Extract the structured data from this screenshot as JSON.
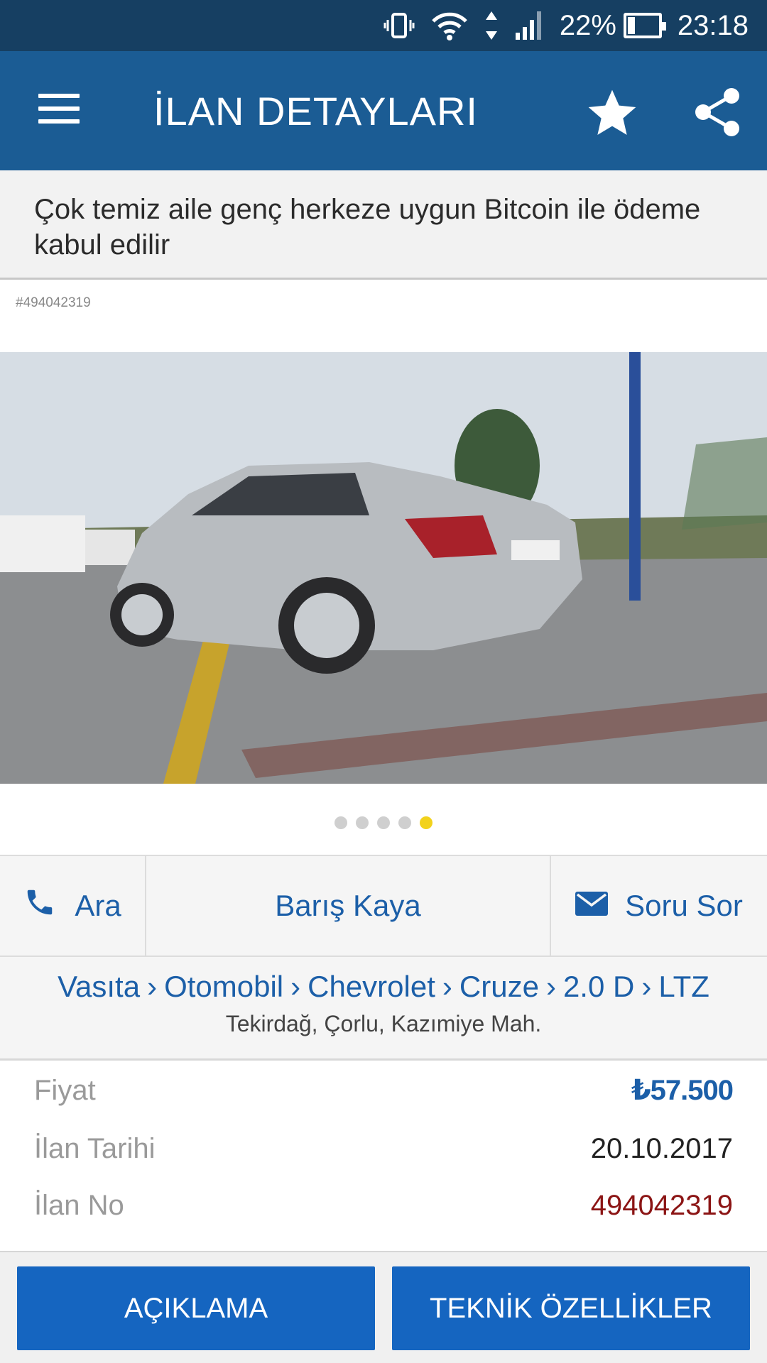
{
  "status_bar": {
    "battery_percent": "22%",
    "battery_level": 0.22,
    "time": "23:18"
  },
  "app_bar": {
    "title": "İLAN DETAYLARI"
  },
  "listing": {
    "title": "Çok temiz aile genç herkeze uygun Bitcoin ile ödeme kabul edilir",
    "hash_id": "#494042319"
  },
  "gallery": {
    "photo_count": 5,
    "active_index": 4
  },
  "actions": {
    "call_label": "Ara",
    "seller_name": "Barış Kaya",
    "ask_label": "Soru Sor"
  },
  "breadcrumb": [
    "Vasıta",
    "Otomobil",
    "Chevrolet",
    "Cruze",
    "2.0 D",
    "LTZ"
  ],
  "breadcrumb_separator": "›",
  "location": "Tekirdağ, Çorlu, Kazımiye Mah.",
  "details": {
    "price_label": "Fiyat",
    "price_value": "₺57.500",
    "date_label": "İlan Tarihi",
    "date_value": "20.10.2017",
    "no_label": "İlan No",
    "no_value": "494042319"
  },
  "bottom_buttons": {
    "description": "AÇIKLAMA",
    "technical": "TEKNİK ÖZELLİKLER"
  },
  "colors": {
    "status_bar": "#163f62",
    "app_bar": "#1b5c94",
    "link_blue": "#1c5fa8",
    "button_blue": "#1565c0",
    "active_dot": "#f2d21b",
    "ilan_no": "#8b1414"
  }
}
